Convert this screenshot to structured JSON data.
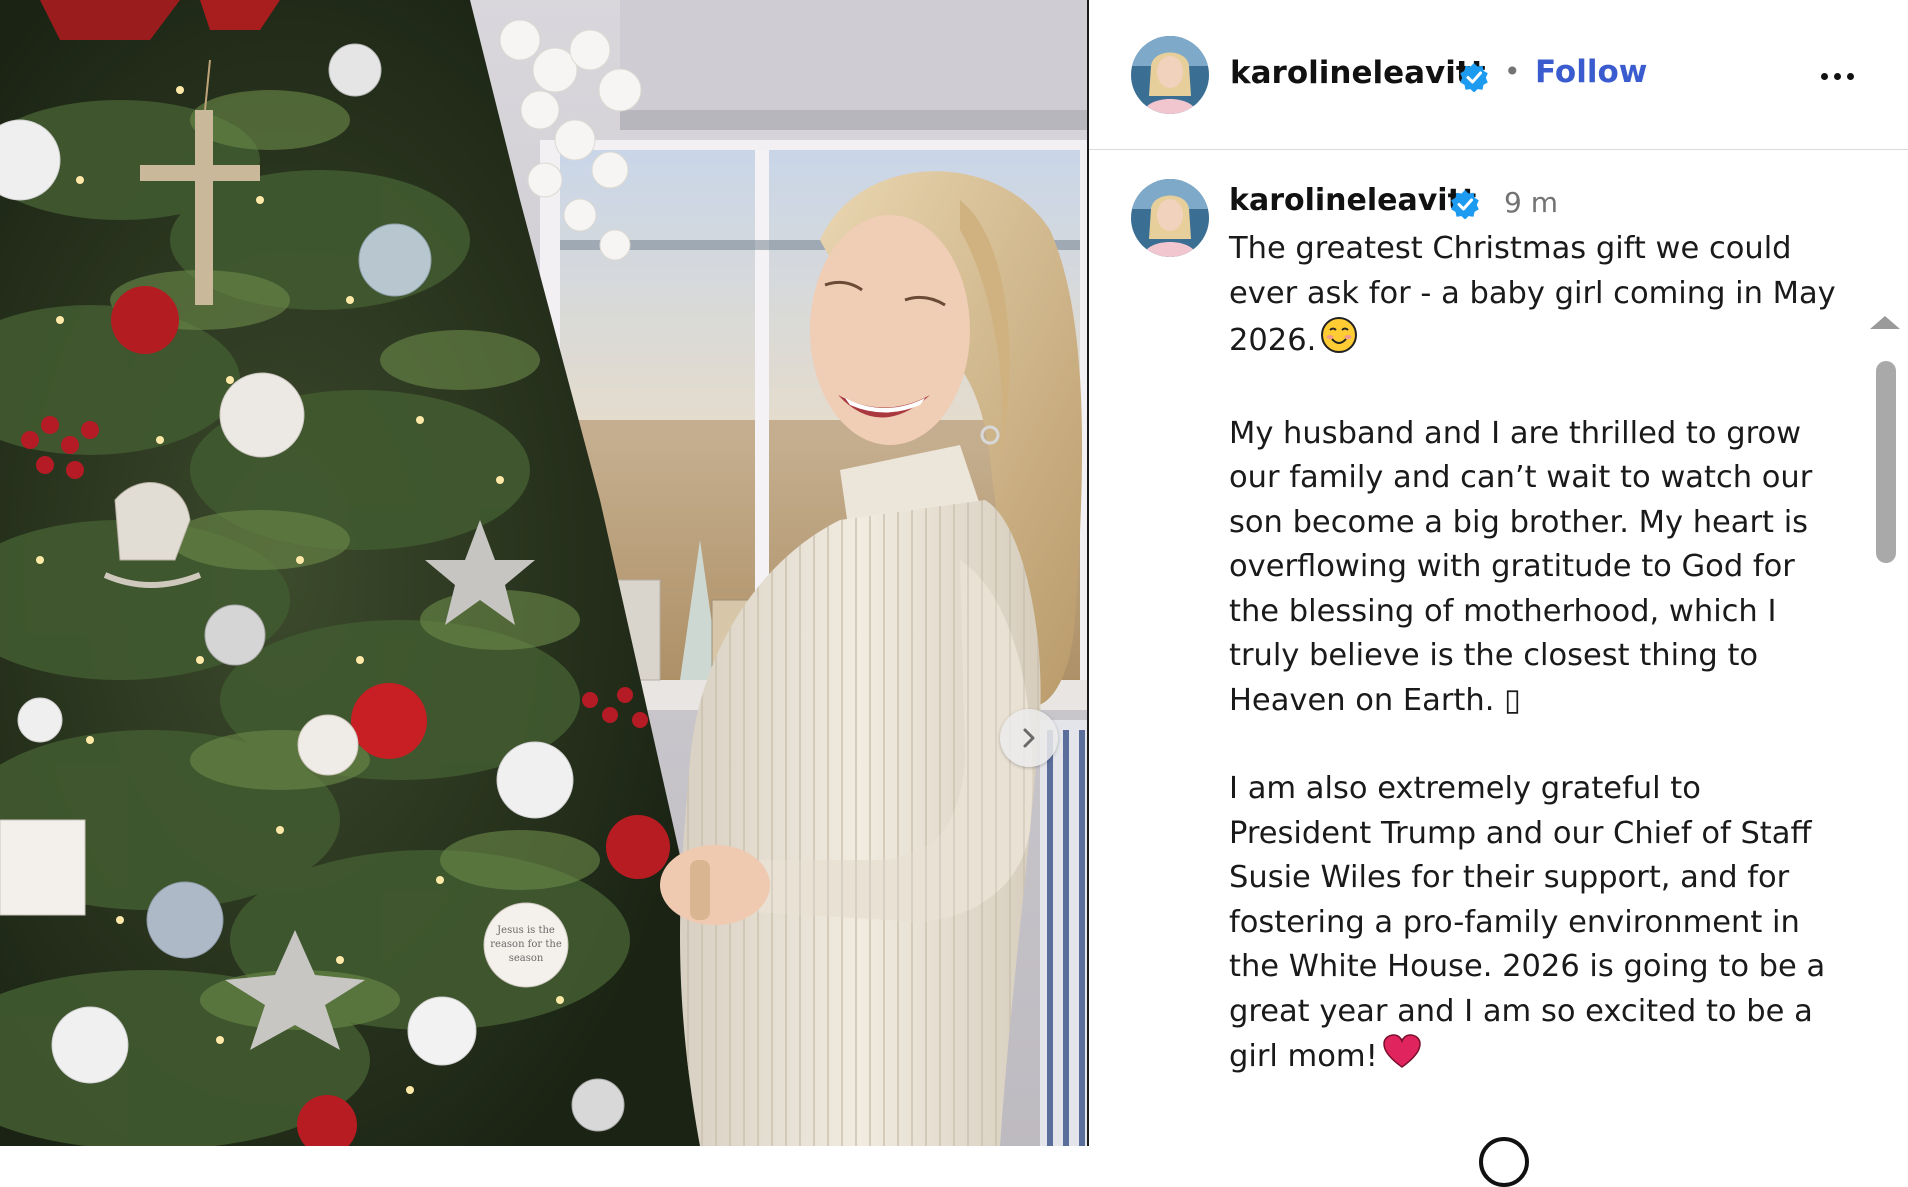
{
  "post": {
    "author": "karolineleavitt",
    "follow_label": "Follow",
    "separator": "•",
    "more_options_icon": "more-horizontal-icon"
  },
  "caption": {
    "author": "karolineleavitt",
    "timestamp": "9 m",
    "paragraph1": "The greatest Christmas gift we could ever ask for - a baby girl coming in May 2026.",
    "paragraph1_emoji": "😊",
    "paragraph2": "My husband and I are thrilled to grow our family and can’t wait to watch our son become a big brother. My heart is overflowing with gratitude to God for the blessing of motherhood, which I truly believe is the closest thing to Heaven on Earth. ▯",
    "paragraph3": "I am also extremely grateful to President Trump and our Chief of Staff Susie Wiles for their support, and for fostering a pro-family environment in the White House. 2026 is going to be a great year and I am so excited to be a girl mom!",
    "paragraph3_emoji": "❤"
  },
  "media": {
    "next_icon": "chevron-right-icon",
    "ornament_text": "Jesus is the reason for the season"
  },
  "colors": {
    "link_blue": "#3b5ccf",
    "verified_blue": "#1d9bf0",
    "heart_red": "#e0245e"
  }
}
